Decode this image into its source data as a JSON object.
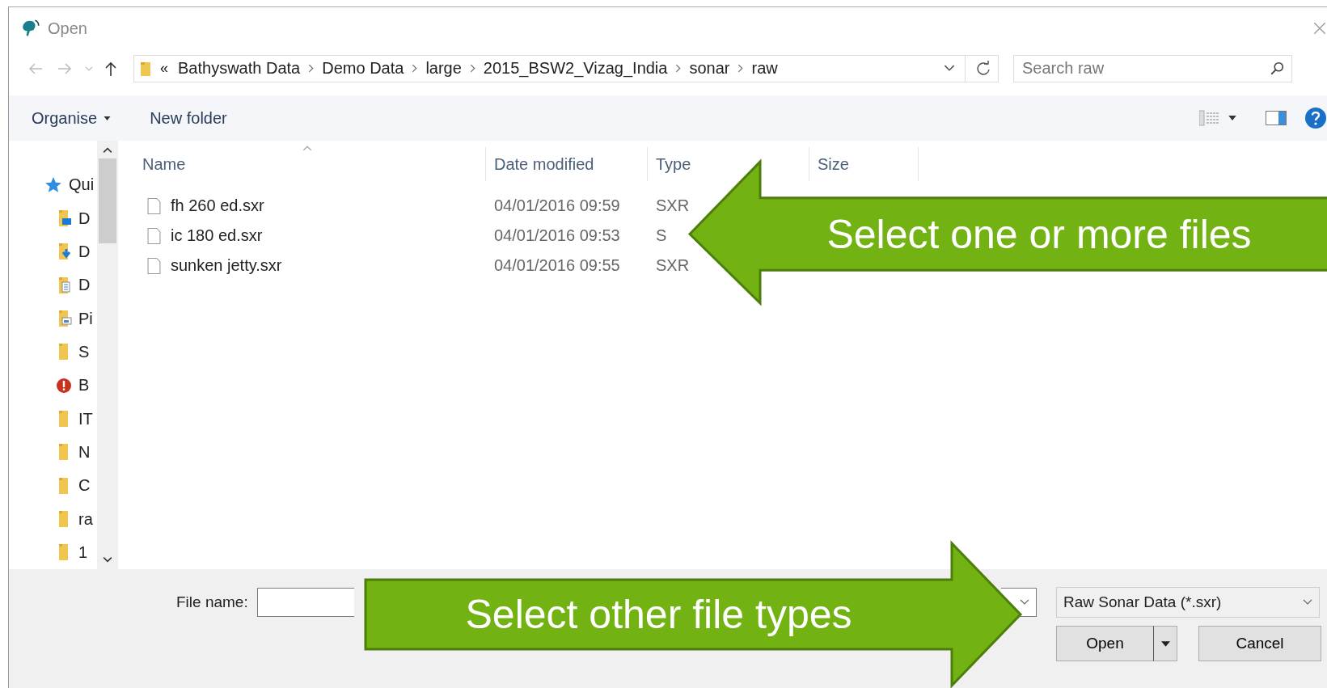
{
  "window": {
    "title": "Open"
  },
  "address": {
    "overflow_marker": "«",
    "crumbs": [
      "Bathyswath Data",
      "Demo Data",
      "large",
      "2015_BSW2_Vizag_India",
      "sonar",
      "raw"
    ]
  },
  "search": {
    "placeholder": "Search raw"
  },
  "toolbar": {
    "organise": "Organise",
    "new_folder": "New folder"
  },
  "sidebar": {
    "items": [
      {
        "label": "Qui",
        "kind": "star"
      },
      {
        "label": "D",
        "kind": "desktop"
      },
      {
        "label": "D",
        "kind": "download"
      },
      {
        "label": "D",
        "kind": "documents"
      },
      {
        "label": "Pi",
        "kind": "pictures"
      },
      {
        "label": "S",
        "kind": "folder"
      },
      {
        "label": "B",
        "kind": "warning"
      },
      {
        "label": "IT",
        "kind": "folder"
      },
      {
        "label": "N",
        "kind": "folder"
      },
      {
        "label": "C",
        "kind": "folder"
      },
      {
        "label": "ra",
        "kind": "folder"
      },
      {
        "label": "1",
        "kind": "folder"
      }
    ]
  },
  "table": {
    "columns": [
      "Name",
      "Date modified",
      "Type",
      "Size"
    ],
    "rows": [
      {
        "name": "fh 260 ed.sxr",
        "date": "04/01/2016 09:59",
        "type": "SXR"
      },
      {
        "name": "ic 180 ed.sxr",
        "date": "04/01/2016 09:53",
        "type": "S"
      },
      {
        "name": "sunken jetty.sxr",
        "date": "04/01/2016 09:55",
        "type": "SXR"
      }
    ]
  },
  "footer": {
    "file_name_label": "File name:",
    "file_type": "Raw Sonar Data (*.sxr)",
    "open": "Open",
    "cancel": "Cancel"
  },
  "callouts": [
    {
      "text": "Select one or more files",
      "kind": "left"
    },
    {
      "text": "Select other file types",
      "kind": "right"
    }
  ]
}
